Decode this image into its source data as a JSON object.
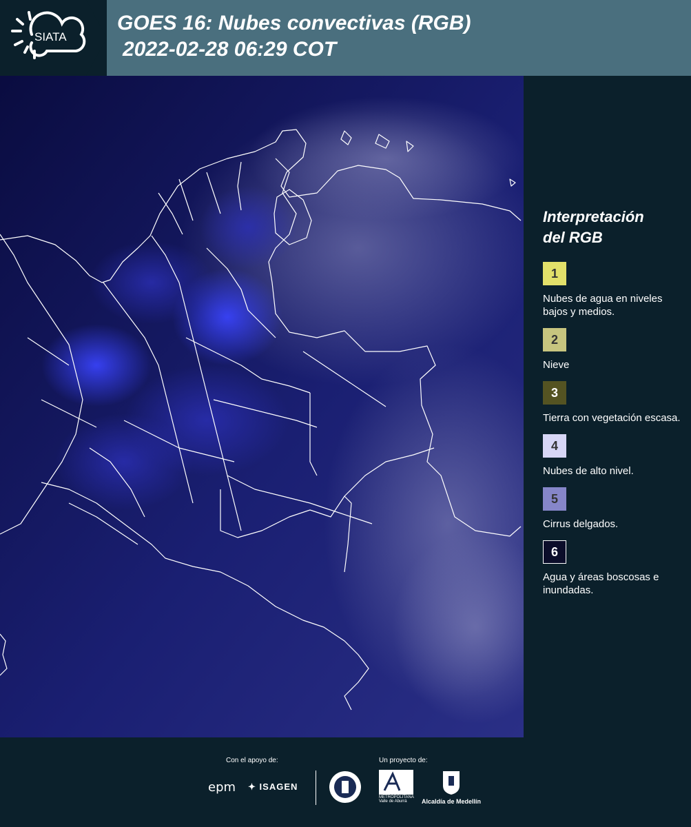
{
  "header": {
    "logo_text": "SIATA",
    "title_line1": "GOES 16: Nubes convectivas (RGB)",
    "title_line2": "2022-02-28 06:29 COT"
  },
  "legend": {
    "title_line1": "Interpretación",
    "title_line2": "del RGB",
    "items": [
      {
        "number": "1",
        "label": "Nubes de agua en niveles bajos y medios.",
        "color": "#e2e06a"
      },
      {
        "number": "2",
        "label": "Nieve",
        "color": "#c7c57f"
      },
      {
        "number": "3",
        "label": "Tierra con vegetación escasa.",
        "color": "#545322"
      },
      {
        "number": "4",
        "label": "Nubes de alto nivel.",
        "color": "#d7d6f6"
      },
      {
        "number": "5",
        "label": "Cirrus delgados.",
        "color": "#8686c9"
      },
      {
        "number": "6",
        "label": "Agua y áreas boscosas e inundadas.",
        "color": "#0b0d2a"
      }
    ]
  },
  "footer": {
    "support_label": "Con el apoyo de:",
    "project_label": "Un proyecto de:",
    "epm": "epm",
    "isagen": "ISAGEN",
    "area_label": "METROPOLITANA Valle de Aburrá",
    "alcaldia": "Alcaldía de Medellín"
  },
  "colors": {
    "header_bg": "#4a6f7e",
    "panel_bg": "#0b202b",
    "map_bg": "#0c0f4a"
  }
}
